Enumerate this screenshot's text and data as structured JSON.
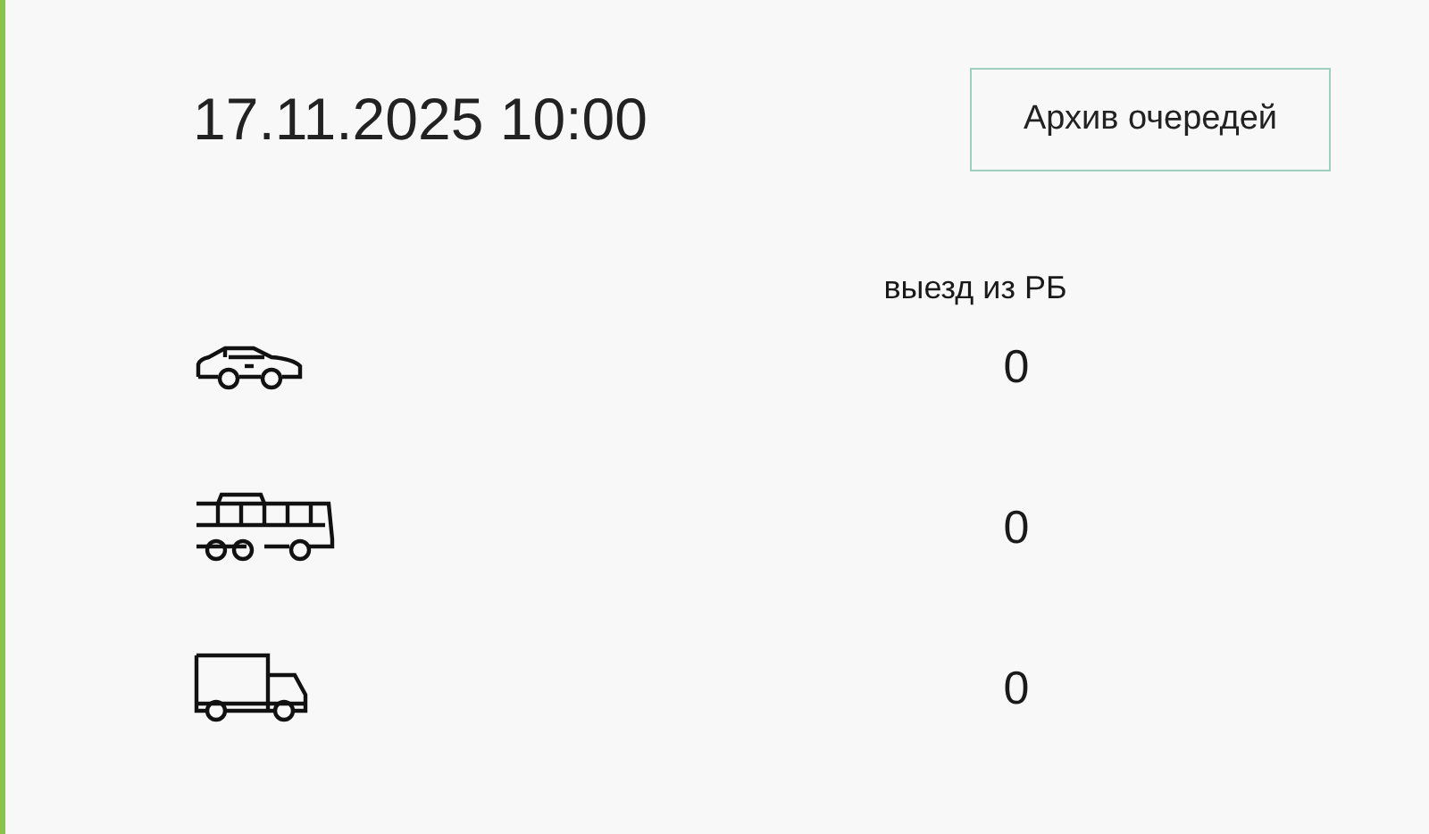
{
  "datetime": "17.11.2025 10:00",
  "archive_button": "Архив очередей",
  "column_header": "выезд из РБ",
  "rows": [
    {
      "kind": "car",
      "value": "0"
    },
    {
      "kind": "bus",
      "value": "0"
    },
    {
      "kind": "truck",
      "value": "0"
    }
  ]
}
